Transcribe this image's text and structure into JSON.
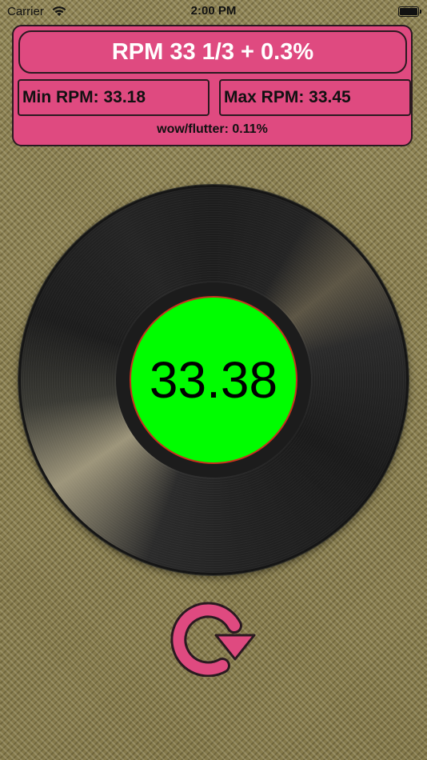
{
  "status_bar": {
    "carrier": "Carrier",
    "time": "2:00 PM"
  },
  "readout": {
    "target_rpm": "RPM 33 1/3 + 0.3%",
    "min_rpm": "Min RPM: 33.18",
    "max_rpm": "Max RPM: 33.45",
    "wow_flutter": "wow/flutter: 0.11%"
  },
  "record": {
    "current_rpm": "33.38"
  },
  "icons": {
    "wifi": "wifi-icon",
    "battery": "battery-icon",
    "reset": "refresh-icon"
  },
  "colors": {
    "panel": "#df4a80",
    "label_ok": "#00fd00",
    "label_ring": "#c8321e",
    "background": "#8c8152"
  }
}
